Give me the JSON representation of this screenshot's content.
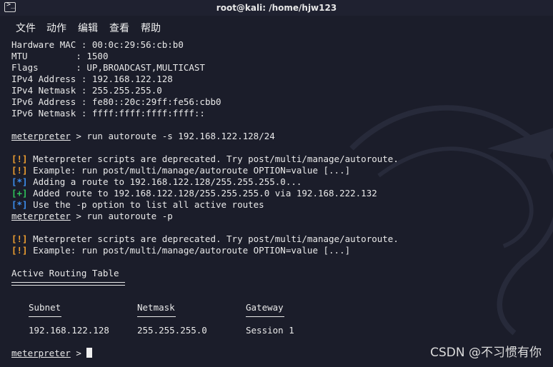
{
  "window": {
    "title": "root@kali: /home/hjw123",
    "icon": "terminal-icon"
  },
  "menu": [
    "文件",
    "动作",
    "编辑",
    "查看",
    "帮助"
  ],
  "iface": [
    {
      "key": "Hardware MAC",
      "pad": " ",
      "value": "00:0c:29:56:cb:b0"
    },
    {
      "key": "MTU",
      "pad": "         ",
      "value": "1500"
    },
    {
      "key": "Flags",
      "pad": "       ",
      "value": "UP,BROADCAST,MULTICAST"
    },
    {
      "key": "IPv4 Address",
      "pad": " ",
      "value": "192.168.122.128"
    },
    {
      "key": "IPv4 Netmask",
      "pad": " ",
      "value": "255.255.255.0"
    },
    {
      "key": "IPv6 Address",
      "pad": " ",
      "value": "fe80::20c:29ff:fe56:cbb0"
    },
    {
      "key": "IPv6 Netmask",
      "pad": " ",
      "value": "ffff:ffff:ffff:ffff::"
    }
  ],
  "prompt": "meterpreter",
  "cmd1": "run autoroute -s 192.168.122.128/24",
  "cmd1_output": [
    {
      "tag": "[!]",
      "kind": "warn",
      "text": "Meterpreter scripts are deprecated. Try post/multi/manage/autoroute."
    },
    {
      "tag": "[!]",
      "kind": "warn",
      "text": "Example: run post/multi/manage/autoroute OPTION=value [...]"
    },
    {
      "tag": "[*]",
      "kind": "info",
      "text": "Adding a route to 192.168.122.128/255.255.255.0..."
    },
    {
      "tag": "[+]",
      "kind": "good",
      "text": "Added route to 192.168.122.128/255.255.255.0 via 192.168.222.132"
    },
    {
      "tag": "[*]",
      "kind": "info",
      "text": "Use the -p option to list all active routes"
    }
  ],
  "cmd2": "run autoroute -p",
  "cmd2_output": [
    {
      "tag": "[!]",
      "kind": "warn",
      "text": "Meterpreter scripts are deprecated. Try post/multi/manage/autoroute."
    },
    {
      "tag": "[!]",
      "kind": "warn",
      "text": "Example: run post/multi/manage/autoroute OPTION=value [...]"
    }
  ],
  "routing_table": {
    "title": "Active Routing Table",
    "columns": [
      "Subnet",
      "Netmask",
      "Gateway"
    ],
    "rows": [
      [
        "192.168.122.128",
        "255.255.255.0",
        "Session 1"
      ]
    ]
  },
  "watermark": "CSDN @不习惯有你",
  "colors": {
    "background": "#1b1d2a",
    "warn": "#f0a030",
    "info": "#3d8ff0",
    "good": "#2fc45a",
    "text": "#e9e9e9"
  }
}
